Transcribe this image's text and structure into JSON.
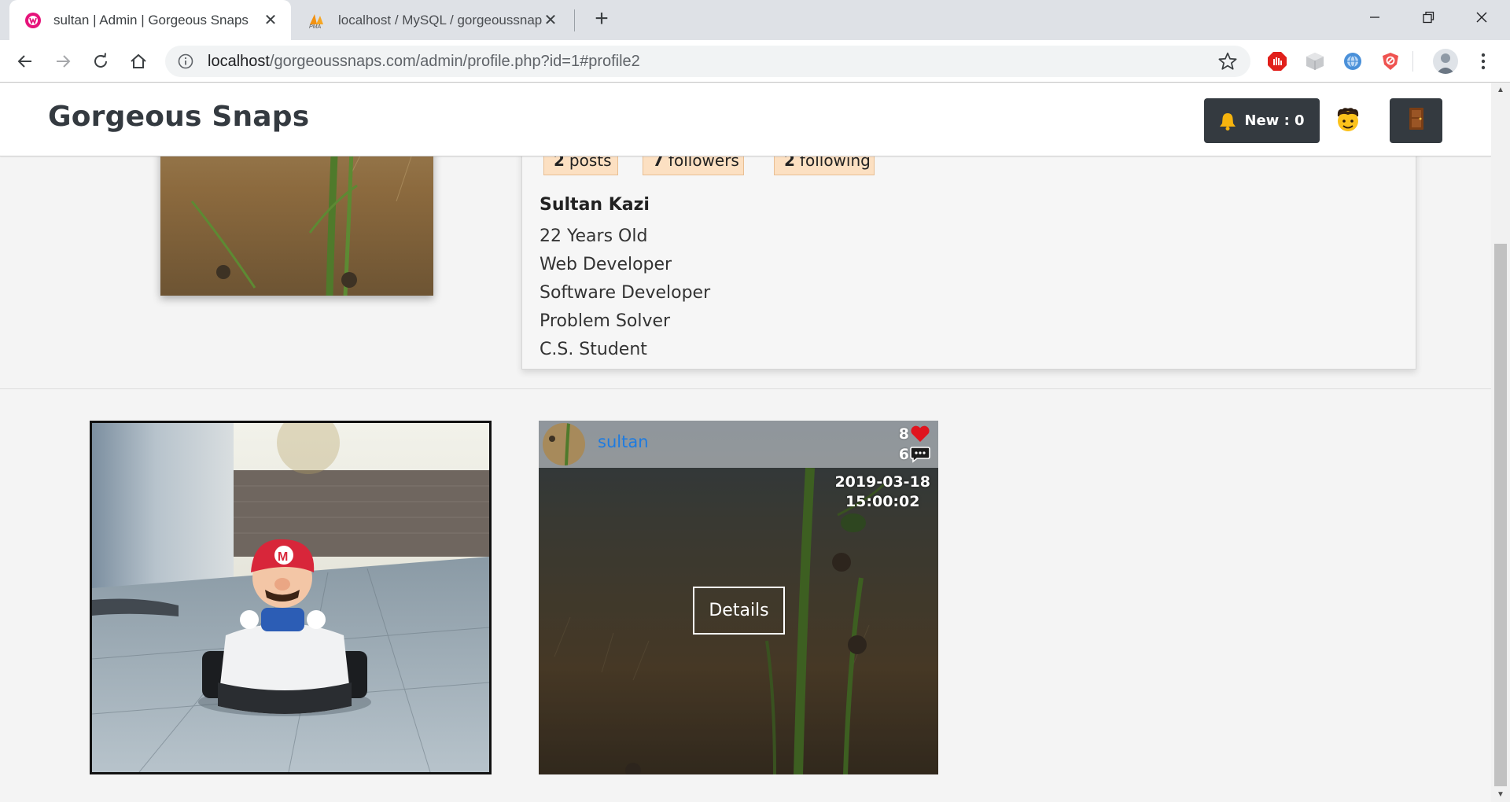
{
  "browser": {
    "tabs": [
      {
        "title": "sultan | Admin | Gorgeous Snaps",
        "active": true
      },
      {
        "title": "localhost / MySQL / gorgeoussnaps",
        "active": false
      }
    ],
    "url_host": "localhost",
    "url_path": "/gorgeoussnaps.com/admin/profile.php?id=1#profile2"
  },
  "navbar": {
    "brand": "Gorgeous Snaps",
    "new_label": "New : 0"
  },
  "profile": {
    "stats": [
      {
        "count": "2",
        "label": "posts"
      },
      {
        "count": "7",
        "label": "followers"
      },
      {
        "count": "2",
        "label": "following"
      }
    ],
    "name": "Sultan Kazi",
    "bio": [
      "22 Years Old",
      "Web Developer",
      "Software Developer",
      "Problem Solver",
      "C.S. Student"
    ]
  },
  "post": {
    "username": "sultan",
    "likes": "8",
    "comments": "6",
    "date": "2019-03-18",
    "time": "15:00:02",
    "details_label": "Details"
  },
  "colors": {
    "accent_link": "#1e7be0",
    "dark_button": "#343a40",
    "stat_bg": "#fce0c2"
  }
}
